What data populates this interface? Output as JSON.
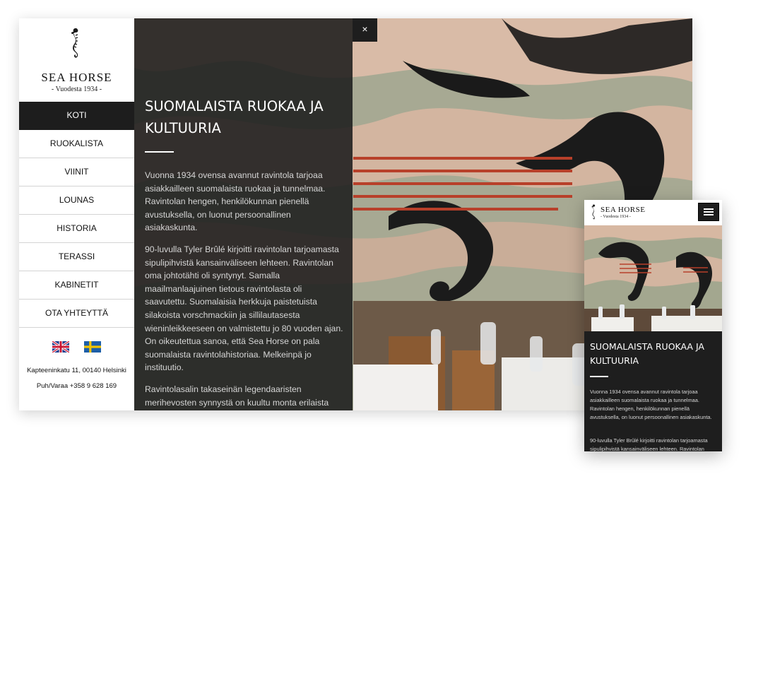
{
  "brand": {
    "name": "SEA HORSE",
    "tagline": "- Vuodesta 1934 -"
  },
  "nav": {
    "items": [
      {
        "label": "KOTI",
        "active": true
      },
      {
        "label": "RUOKALISTA"
      },
      {
        "label": "VIINIT"
      },
      {
        "label": "LOUNAS"
      },
      {
        "label": "HISTORIA"
      },
      {
        "label": "TERASSI"
      },
      {
        "label": "KABINETIT"
      },
      {
        "label": "OTA YHTEYTTÄ"
      }
    ]
  },
  "languages": [
    {
      "icon": "uk-flag-icon"
    },
    {
      "icon": "sweden-flag-icon"
    }
  ],
  "contact": {
    "address": "Kapteeninkatu 11, 00140 Helsinki",
    "phone": "Puh/Varaa +358 9 628 169"
  },
  "article": {
    "close_label": "×",
    "title": "SUOMALAISTA RUOKAA JA KULTUURIA",
    "paragraphs": [
      "Vuonna 1934 ovensa avannut ravintola tarjoaa asiakkailleen suomalaista ruokaa ja tunnelmaa. Ravintolan hengen, henkilökunnan pienellä avustuksella, on luonut persoonallinen asiakaskunta.",
      "90-luvulla Tyler Brûlé kirjoitti ravintolan tarjoamasta sipulipihvistä kansainväliseen lehteen. Ravintolan oma johtotähti oli syntynyt. Samalla maailmanlaajuinen tietous ravintolasta oli saavutettu. Suomalaisia herkkuja paistetuista silakoista vorschmackiin ja sillilautasesta wieninleikkeeseen on valmistettu jo 80 vuoden ajan. On oikeutettua sanoa, että Sea Horse on pala suomalaista ravintolahistoriaa. Melkeinpä jo instituutio.",
      "Ravintolasalin takaseinän legendaaristen merihevosten synnystä on kuultu monta erilaista"
    ]
  },
  "mobile": {
    "brand_name": "SEA HORSE",
    "brand_tagline": "- Vuodesta 1934 -",
    "menu_icon": "hamburger-menu-icon",
    "title": "SUOMALAISTA RUOKAA JA KULTUURIA",
    "paragraphs": [
      "Vuonna 1934 ovensa avannut ravintola tarjoaa asiakkailleen suomalaista ruokaa ja tunnelmaa. Ravintolan hengen, henkilökunnan pienellä avustuksella, on luonut persoonallinen asiakaskunta.",
      "90-luvulla Tyler Brûlé kirjoitti ravintolan tarjoamasta sipulipihvistä kansainväliseen lehteen. Ravintolan"
    ]
  },
  "colors": {
    "accent_dark": "#1d1d1d",
    "mural_green": "#9aa48a",
    "mural_pink": "#d7b8a2",
    "mural_red": "#b8402a"
  }
}
